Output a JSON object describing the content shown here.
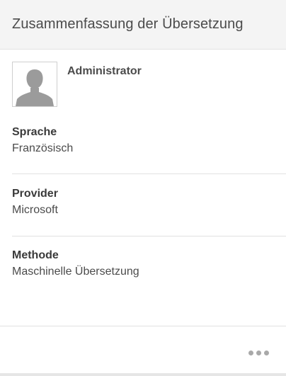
{
  "header": {
    "title": "Zusammenfassung der Übersetzung"
  },
  "user": {
    "name": "Administrator",
    "avatar_icon": "user-silhouette-icon"
  },
  "details": [
    {
      "label": "Sprache",
      "value": "Französisch"
    },
    {
      "label": "Provider",
      "value": "Microsoft"
    },
    {
      "label": "Methode",
      "value": "Maschinelle Übersetzung"
    }
  ],
  "footer": {
    "more_icon": "more-horizontal-icon"
  },
  "colors": {
    "header_bg": "#f4f4f4",
    "divider": "#e1e1e1",
    "text": "#4b4b4b",
    "dots": "#a9a9a9"
  }
}
